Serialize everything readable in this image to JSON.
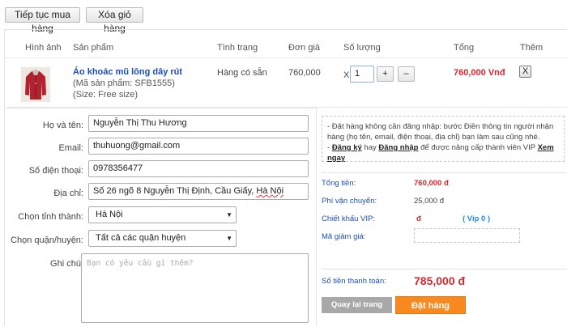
{
  "top_buttons": {
    "continue": "Tiếp tục mua hàng",
    "clear": "Xóa giỏ hàng"
  },
  "table": {
    "headers": [
      "Hình ảnh",
      "Sản phẩm",
      "Tình trạng",
      "Đơn giá",
      "Số lượng",
      "Tổng",
      "Thêm"
    ],
    "item": {
      "name": "Áo khoác mũ lông dây rút",
      "code": "(Mã sản phẩm: SFB1555)",
      "size": "(Size: Free size)",
      "status": "Hàng có sẵn",
      "unit_price": "760,000",
      "qty_prefix": "X",
      "qty": "1",
      "plus": "+",
      "minus": "–",
      "total": "760,000 Vnđ",
      "remove": "X"
    }
  },
  "form": {
    "name": {
      "label": "Họ và tên:",
      "value": "Nguyễn Thị Thu Hương"
    },
    "email": {
      "label": "Email:",
      "value": "thuhuong@gmail.com"
    },
    "phone": {
      "label": "Số điện thoại:",
      "value": "0978356477"
    },
    "address": {
      "label": "Địa chỉ:",
      "value_pre": "Số 26 ngõ 8 Nguyễn Thị Định, Cầu Giấy, ",
      "value_city": "Hà Nội"
    },
    "province": {
      "label": "Chọn tỉnh thành:",
      "value": "Hà Nội"
    },
    "district": {
      "label": "Chọn quận/huyện:",
      "value": "Tất cả các quận huyện"
    },
    "note": {
      "label": "Ghi chú:",
      "placeholder": "Bạn có yêu cầu gì thêm?"
    }
  },
  "notice": {
    "line1": "- Đặt hàng không cần đăng nhập: bước Điền thông tin người nhận hàng (họ tên, email, điện thoại, địa chỉ) bạn làm sau cũng nhé.",
    "line2_prefix": "- ",
    "register": "Đăng ký",
    "or": " hay ",
    "login": "Đăng nhập",
    "line2_mid": " để được nâng cấp thành viên VIP ",
    "see_now": "Xem ngay"
  },
  "summary": {
    "total_label": "Tổng tiền:",
    "total_value": "760,000 đ",
    "ship_label": "Phí vận chuyển:",
    "ship_value": "25,000 đ",
    "vip_label": "Chiết khấu VIP:",
    "vip_value": "đ",
    "vip_tag": "( Vip 0 )",
    "coupon_label": "Mã giảm giá:",
    "grand_label": "Số tiền thanh toán:",
    "grand_value": "785,000 đ",
    "back_button": "Quay lại trang trước",
    "order_button": "Đặt hàng"
  },
  "colors": {
    "price_red": "#d9262b",
    "link_blue": "#1a4fb4",
    "order_orange": "#f7891e",
    "back_gray": "#a8a8a8"
  }
}
